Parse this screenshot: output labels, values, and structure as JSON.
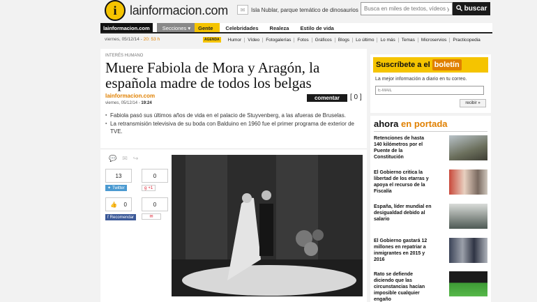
{
  "header": {
    "logo_letter": "i",
    "logo_text": "lainformacion.com",
    "promo_text": "Isla Nublar, parque temático de dinosaurios",
    "search_placeholder": "Busca en miles de textos, vídeos y fotos",
    "search_button": "buscar"
  },
  "nav": {
    "site": "lainformacion.com",
    "secciones": "Secciones",
    "gente": "Gente",
    "items": [
      "Celebridades",
      "Realeza",
      "Estilo de vida"
    ]
  },
  "subnav": {
    "tag": "AGENDA",
    "items": [
      "Humor",
      "Vídeo",
      "Fotogalerías",
      "Fotos",
      "Gráficos",
      "Blogs",
      "Lo último",
      "Lo más",
      "Temas",
      "Microservios",
      "Practicopedia"
    ]
  },
  "datebar": {
    "date": "viernes, 05/12/14 -",
    "time": "20: 53 h"
  },
  "article": {
    "category": "INTERÉS HUMANO",
    "headline": "Muere Fabiola de Mora y Aragón, la española madre de todos los belgas",
    "source": "lainformacion.com",
    "date": "viernes, 05/12/14 -",
    "time": "19:24",
    "comment_button": "comentar",
    "comment_count": "[ 0 ]",
    "bullets": [
      "Fabiola pasó sus últimos años de vida en el palacio de Stuyvenberg, a las afueras de Bruselas.",
      "La retransmisión televisiva de su boda con Balduino en 1960 fue el primer programa de exterior de TVE."
    ]
  },
  "share": {
    "twitter_count": "13",
    "twitter_label": "Twitter",
    "gplus_count": "0",
    "gplus_label": "+1",
    "like_count": "0",
    "fb_label": "Recomendar",
    "other_count": "0"
  },
  "newsletter": {
    "title_a": "Suscríbete a el",
    "title_b": "boletín",
    "text": "La mejor información a diario en tu correo.",
    "email_placeholder": "E-MAIL",
    "send_button": "recibir »"
  },
  "ahora": {
    "title_a": "ahora",
    "title_b": "en portada",
    "stories": [
      "Retenciones de hasta 140 kilómetros por el Puente de la Constitución",
      "El Gobierno critica la libertad de los etarras y apoya el recurso de la Fiscalía",
      "España, líder mundial en desigualdad debido al salario",
      "El Gobierno gastará 12 millones en repatriar a inmigrantes en 2015 y 2016",
      "Rato se defiende diciendo que las circunstancias hacían imposible cualquier engaño"
    ]
  },
  "colors": {
    "accent": "#f5c400",
    "orange": "#e08000",
    "dark": "#1a1a1a"
  }
}
